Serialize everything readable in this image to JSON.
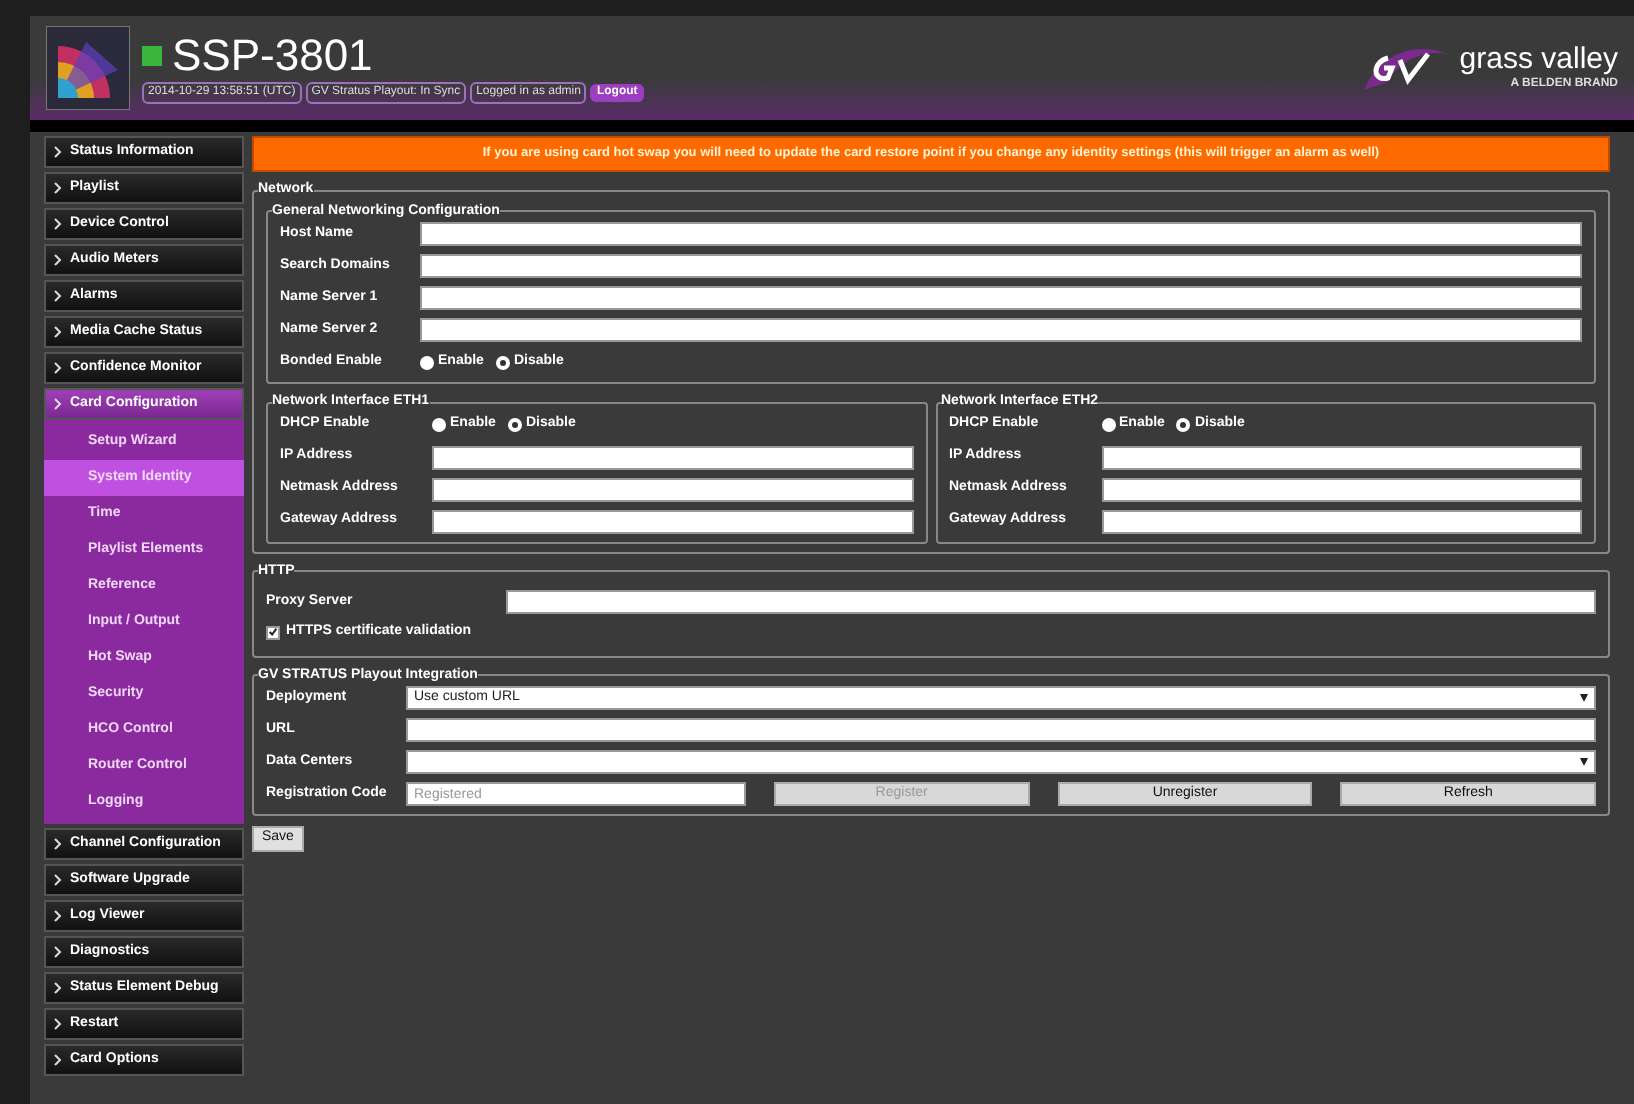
{
  "header": {
    "title": "SSP-3801",
    "status": [
      {
        "text": "2014-10-29 13:58:51 (UTC)"
      },
      {
        "text": "GV Stratus Playout: In Sync"
      },
      {
        "text": "Logged in as admin"
      }
    ],
    "logout": "Logout",
    "brand": "grass valley",
    "brand_sub": "A BELDEN BRAND"
  },
  "sidebar": {
    "items": [
      {
        "label": "Status Information",
        "selected": false
      },
      {
        "label": "Playlist",
        "selected": false
      },
      {
        "label": "Device Control",
        "selected": false
      },
      {
        "label": "Audio Meters",
        "selected": false
      },
      {
        "label": "Alarms",
        "selected": false
      },
      {
        "label": "Media Cache Status",
        "selected": false
      },
      {
        "label": "Confidence Monitor",
        "selected": false
      },
      {
        "label": "Card Configuration",
        "selected": true,
        "children": [
          {
            "label": "Setup Wizard",
            "selected": false
          },
          {
            "label": "System Identity",
            "selected": true
          },
          {
            "label": "Time",
            "selected": false
          },
          {
            "label": "Playlist Elements",
            "selected": false
          },
          {
            "label": "Reference",
            "selected": false
          },
          {
            "label": "Input / Output",
            "selected": false
          },
          {
            "label": "Hot Swap",
            "selected": false
          },
          {
            "label": "Security",
            "selected": false
          },
          {
            "label": "HCO Control",
            "selected": false
          },
          {
            "label": "Router Control",
            "selected": false
          },
          {
            "label": "Logging",
            "selected": false
          }
        ]
      },
      {
        "label": "Channel Configuration",
        "selected": false
      },
      {
        "label": "Software Upgrade",
        "selected": false
      },
      {
        "label": "Log Viewer",
        "selected": false
      },
      {
        "label": "Diagnostics",
        "selected": false
      },
      {
        "label": "Status Element Debug",
        "selected": false
      },
      {
        "label": "Restart",
        "selected": false
      },
      {
        "label": "Card Options",
        "selected": false
      }
    ]
  },
  "banner": "If you are using card hot swap you will need to update the card restore point if you change any identity settings (this will trigger an alarm as well)",
  "network": {
    "legend": "Network",
    "general": {
      "legend": "General Networking Configuration",
      "fields": [
        {
          "label": "Host Name"
        },
        {
          "label": "Search Domains"
        },
        {
          "label": "Name Server 1"
        },
        {
          "label": "Name Server 2"
        }
      ],
      "bonded": {
        "label": "Bonded Enable",
        "options": [
          {
            "label": "Enable",
            "selected": false
          },
          {
            "label": "Disable",
            "selected": true
          }
        ]
      }
    },
    "interfaces": [
      {
        "legend": "Network Interface ETH1",
        "dhcp": {
          "label": "DHCP Enable",
          "options": [
            {
              "label": "Enable",
              "selected": false
            },
            {
              "label": "Disable",
              "selected": true
            }
          ]
        },
        "fields": [
          {
            "label": "IP Address"
          },
          {
            "label": "Netmask Address"
          },
          {
            "label": "Gateway Address"
          }
        ]
      },
      {
        "legend": "Network Interface ETH2",
        "dhcp": {
          "label": "DHCP Enable",
          "options": [
            {
              "label": "Enable",
              "selected": false
            },
            {
              "label": "Disable",
              "selected": true
            }
          ]
        },
        "fields": [
          {
            "label": "IP Address"
          },
          {
            "label": "Netmask Address"
          },
          {
            "label": "Gateway Address"
          }
        ]
      }
    ]
  },
  "http": {
    "legend": "HTTP",
    "proxy_label": "Proxy Server",
    "https_validation": {
      "label": "HTTPS certificate validation",
      "checked": true
    }
  },
  "stratus": {
    "legend": "GV STRATUS Playout Integration",
    "rows": [
      {
        "kind": "select",
        "label": "Deployment",
        "value": "Use custom URL"
      },
      {
        "kind": "text",
        "label": "URL"
      },
      {
        "kind": "select",
        "label": "Data Centers"
      }
    ],
    "registration": {
      "label": "Registration Code",
      "value": "Registered",
      "disabled": true
    },
    "buttons": [
      {
        "label": "Register",
        "disabled": true
      },
      {
        "label": "Unregister",
        "disabled": false
      },
      {
        "label": "Refresh",
        "disabled": false
      }
    ]
  },
  "save": "Save"
}
